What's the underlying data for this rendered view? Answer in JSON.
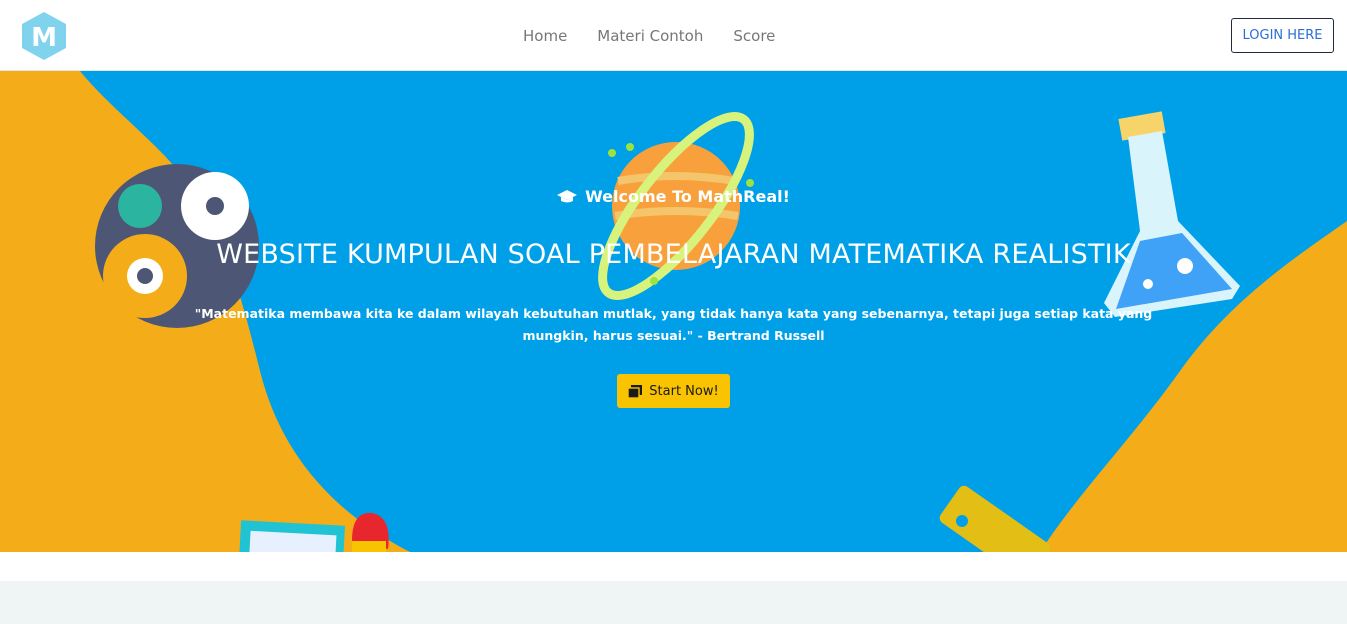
{
  "brand": {
    "logo_letter": "M",
    "logo_color": "#7fd3ec"
  },
  "nav": {
    "items": [
      {
        "label": "Home"
      },
      {
        "label": "Materi Contoh"
      },
      {
        "label": "Score"
      }
    ],
    "login_label": "LOGIN HERE"
  },
  "hero": {
    "welcome": "Welcome To MathReal!",
    "welcome_icon": "graduation-cap-icon",
    "title": "WEBSITE KUMPULAN SOAL PEMBELAJARAN MATEMATIKA REALISTIK",
    "quote": "\"Matematika membawa kita ke dalam wilayah kebutuhan mutlak, yang tidak hanya kata yang sebenarnya, tetapi juga setiap kata yang mungkin, harus sesuai.\" - Bertrand Russell",
    "cta_label": "Start Now!",
    "cta_icon": "copy-icon",
    "colors": {
      "blue": "#00a0e9",
      "orange": "#f4ad18",
      "button": "#f9c300"
    }
  }
}
